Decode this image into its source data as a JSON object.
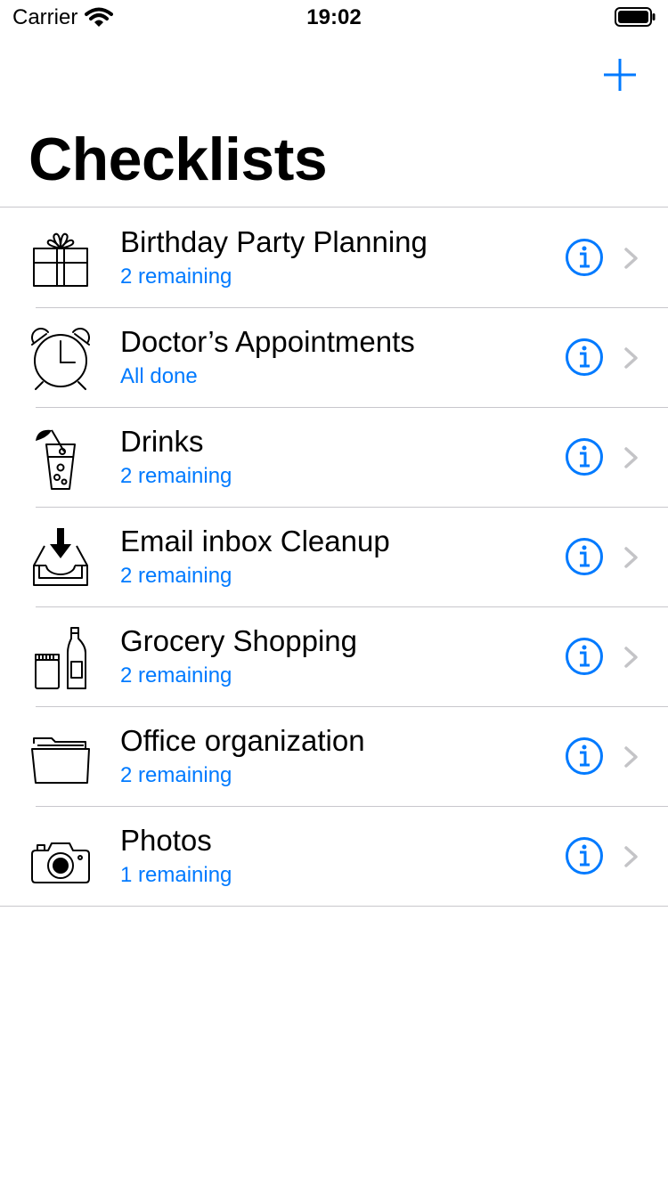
{
  "status_bar": {
    "carrier": "Carrier",
    "time": "19:02",
    "wifi_icon": "wifi-icon",
    "battery_icon": "battery-icon"
  },
  "nav": {
    "add_icon": "plus-icon",
    "title": "Checklists"
  },
  "accent_color": "#007aff",
  "checklists": [
    {
      "title": "Birthday Party Planning",
      "subtitle": "2 remaining",
      "icon": "gift-icon"
    },
    {
      "title": "Doctor’s Appointments",
      "subtitle": "All done",
      "icon": "alarm-clock-icon"
    },
    {
      "title": "Drinks",
      "subtitle": "2 remaining",
      "icon": "drink-icon"
    },
    {
      "title": "Email inbox Cleanup",
      "subtitle": "2 remaining",
      "icon": "inbox-icon"
    },
    {
      "title": "Grocery Shopping",
      "subtitle": "2 remaining",
      "icon": "groceries-icon"
    },
    {
      "title": "Office organization",
      "subtitle": "2 remaining",
      "icon": "folder-icon"
    },
    {
      "title": "Photos",
      "subtitle": "1 remaining",
      "icon": "camera-icon"
    }
  ]
}
